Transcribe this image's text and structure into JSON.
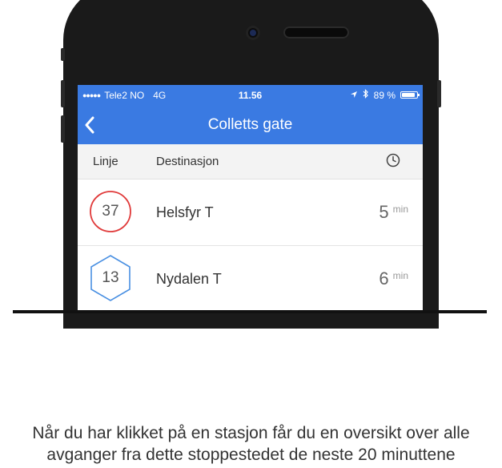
{
  "status_bar": {
    "signal": "●●●●●",
    "carrier": "Tele2 NO",
    "network": "4G",
    "time": "11.56",
    "location_icon": "location-arrow-icon",
    "bluetooth_icon": "bluetooth-icon",
    "battery_percent": "89 %",
    "battery_level": 0.89
  },
  "navbar": {
    "back_icon": "chevron-left-icon",
    "title": "Colletts gate"
  },
  "table_header": {
    "line_label": "Linje",
    "destination_label": "Destinasjon",
    "clock_icon": "clock-icon"
  },
  "departures": [
    {
      "line": "37",
      "line_shape": "circle",
      "line_color": "#e03a3a",
      "destination": "Helsfyr T",
      "minutes": "5",
      "unit": "min"
    },
    {
      "line": "13",
      "line_shape": "hexagon",
      "line_color": "#4a90e2",
      "destination": "Nydalen T",
      "minutes": "6",
      "unit": "min"
    }
  ],
  "caption": {
    "line1": "Når du har klikket på en stasjon får du en oversikt over alle",
    "line2": "avganger fra dette stoppestedet de neste 20 minuttene"
  },
  "colors": {
    "brand_blue": "#3a7ae2",
    "header_bg": "#f3f3f3",
    "bus_red": "#e03a3a",
    "tram_blue": "#4a90e2"
  }
}
